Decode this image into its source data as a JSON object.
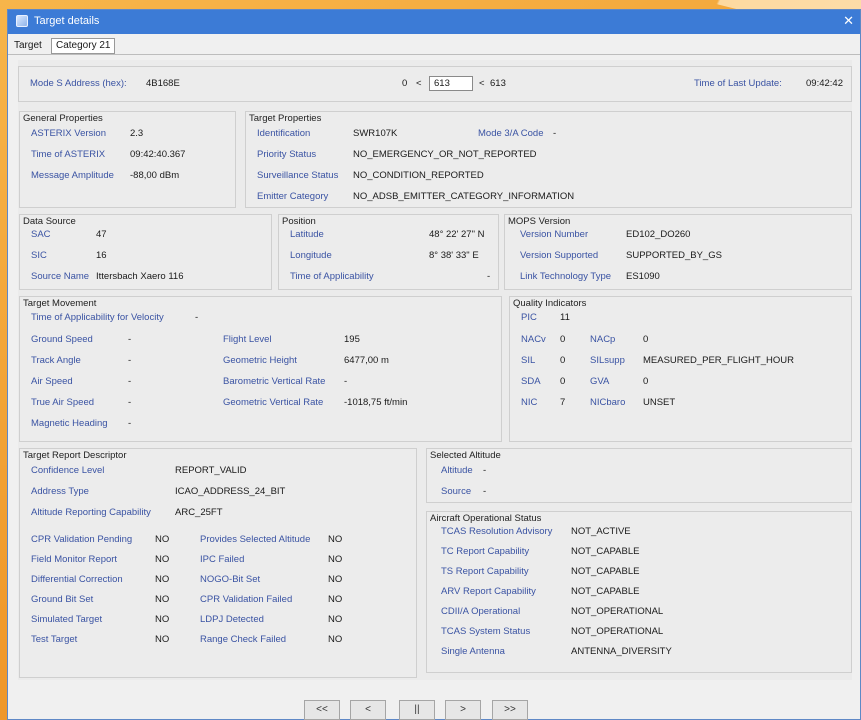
{
  "window": {
    "title": "Target details",
    "close_glyph": "✕"
  },
  "tabs": [
    {
      "label": "Target"
    },
    {
      "label": "Category 21"
    }
  ],
  "header": {
    "mode_s_label": "Mode S Address (hex):",
    "mode_s_value": "4B168E",
    "counter_min": "0",
    "lt1": "<",
    "counter_value": "613",
    "lt2": "<",
    "counter_max": "613",
    "last_update_label": "Time of Last Update:",
    "last_update_value": "09:42:42"
  },
  "general": {
    "title": "General Properties",
    "rows": [
      {
        "label": "ASTERIX Version",
        "value": "2.3"
      },
      {
        "label": "Time of ASTERIX",
        "value": "09:42:40.367"
      },
      {
        "label": "Message Amplitude",
        "value": "-88,00 dBm"
      }
    ]
  },
  "target_props": {
    "title": "Target Properties",
    "identification_label": "Identification",
    "identification_value": "SWR107K",
    "mode3a_label": "Mode 3/A Code",
    "mode3a_value": "-",
    "rows": [
      {
        "label": "Priority Status",
        "value": "NO_EMERGENCY_OR_NOT_REPORTED"
      },
      {
        "label": "Surveillance Status",
        "value": "NO_CONDITION_REPORTED"
      },
      {
        "label": "Emitter Category",
        "value": "NO_ADSB_EMITTER_CATEGORY_INFORMATION"
      }
    ]
  },
  "data_source": {
    "title": "Data Source",
    "rows": [
      {
        "label": "SAC",
        "value": "47"
      },
      {
        "label": "SIC",
        "value": "16"
      },
      {
        "label": "Source Name",
        "value": "Ittersbach Xaero 116"
      }
    ]
  },
  "position": {
    "title": "Position",
    "rows": [
      {
        "label": "Latitude",
        "value": "48° 22' 27\" N"
      },
      {
        "label": "Longitude",
        "value": "8° 38' 33\" E"
      },
      {
        "label": "Time of Applicability",
        "value": "-"
      }
    ]
  },
  "mops": {
    "title": "MOPS Version",
    "rows": [
      {
        "label": "Version Number",
        "value": "ED102_DO260"
      },
      {
        "label": "Version Supported",
        "value": "SUPPORTED_BY_GS"
      },
      {
        "label": "Link Technology Type",
        "value": "ES1090"
      }
    ]
  },
  "movement": {
    "title": "Target Movement",
    "toa_velocity_label": "Time of Applicability for Velocity",
    "toa_velocity_value": "-",
    "left": [
      {
        "label": "Ground Speed",
        "value": "-"
      },
      {
        "label": "Track Angle",
        "value": "-"
      },
      {
        "label": "Air Speed",
        "value": "-"
      },
      {
        "label": "True Air Speed",
        "value": "-"
      },
      {
        "label": "Magnetic Heading",
        "value": "-"
      }
    ],
    "right": [
      {
        "label": "Flight Level",
        "value": "195"
      },
      {
        "label": "Geometric Height",
        "value": "6477,00 m"
      },
      {
        "label": "Barometric Vertical Rate",
        "value": "-"
      },
      {
        "label": "Geometric Vertical Rate",
        "value": "-1018,75 ft/min"
      }
    ]
  },
  "quality": {
    "title": "Quality Indicators",
    "pic_label": "PIC",
    "pic_value": "11",
    "pairs": [
      {
        "l1": "NACv",
        "v1": "0",
        "l2": "NACp",
        "v2": "0"
      },
      {
        "l1": "SIL",
        "v1": "0",
        "l2": "SILsupp",
        "v2": "MEASURED_PER_FLIGHT_HOUR"
      },
      {
        "l1": "SDA",
        "v1": "0",
        "l2": "GVA",
        "v2": "0"
      },
      {
        "l1": "NIC",
        "v1": "7",
        "l2": "NICbaro",
        "v2": "UNSET"
      }
    ]
  },
  "trd": {
    "title": "Target Report Descriptor",
    "top": [
      {
        "label": "Confidence Level",
        "value": "REPORT_VALID"
      },
      {
        "label": "Address Type",
        "value": "ICAO_ADDRESS_24_BIT"
      },
      {
        "label": "Altitude Reporting Capability",
        "value": "ARC_25FT"
      }
    ],
    "left": [
      {
        "label": "CPR Validation Pending",
        "value": "NO"
      },
      {
        "label": "Field Monitor Report",
        "value": "NO"
      },
      {
        "label": "Differential Correction",
        "value": "NO"
      },
      {
        "label": "Ground Bit Set",
        "value": "NO"
      },
      {
        "label": "Simulated Target",
        "value": "NO"
      },
      {
        "label": "Test Target",
        "value": "NO"
      }
    ],
    "right": [
      {
        "label": "Provides Selected Altitude",
        "value": "NO"
      },
      {
        "label": "IPC Failed",
        "value": "NO"
      },
      {
        "label": "NOGO-Bit Set",
        "value": "NO"
      },
      {
        "label": "CPR Validation Failed",
        "value": "NO"
      },
      {
        "label": "LDPJ Detected",
        "value": "NO"
      },
      {
        "label": "Range Check Failed",
        "value": "NO"
      }
    ]
  },
  "selected_alt": {
    "title": "Selected Altitude",
    "rows": [
      {
        "label": "Altitude",
        "value": "-"
      },
      {
        "label": "Source",
        "value": "-"
      }
    ]
  },
  "aos": {
    "title": "Aircraft Operational Status",
    "rows": [
      {
        "label": "TCAS Resolution Advisory",
        "value": "NOT_ACTIVE"
      },
      {
        "label": "TC Report Capability",
        "value": "NOT_CAPABLE"
      },
      {
        "label": "TS Report Capability",
        "value": "NOT_CAPABLE"
      },
      {
        "label": "ARV Report Capability",
        "value": "NOT_CAPABLE"
      },
      {
        "label": "CDII/A Operational",
        "value": "NOT_OPERATIONAL"
      },
      {
        "label": "TCAS System Status",
        "value": "NOT_OPERATIONAL"
      },
      {
        "label": "Single Antenna",
        "value": "ANTENNA_DIVERSITY"
      }
    ]
  },
  "nav": {
    "first": "<<",
    "prev": "<",
    "pause": "||",
    "next": ">",
    "last": ">>"
  }
}
